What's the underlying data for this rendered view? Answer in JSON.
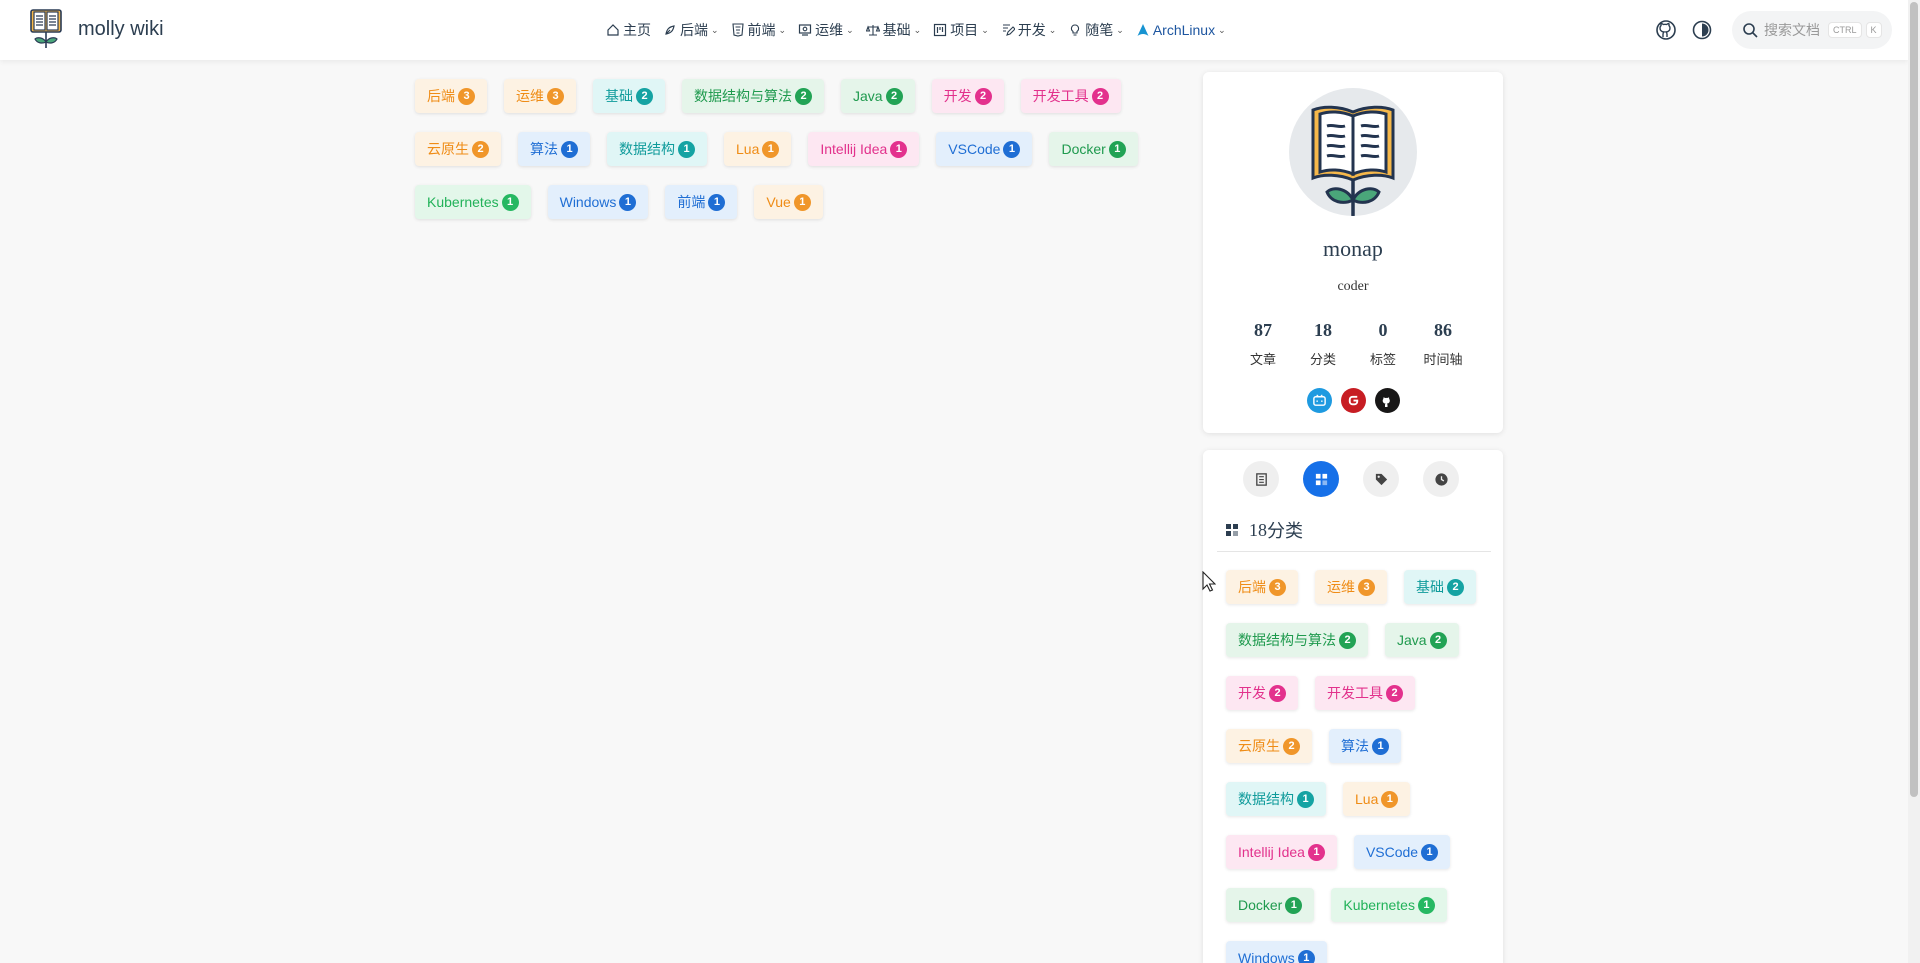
{
  "brand": {
    "title": "molly wiki"
  },
  "nav": {
    "items": [
      {
        "label": "主页",
        "icon": "home-icon",
        "has_menu": false
      },
      {
        "label": "后端",
        "icon": "backend-icon",
        "has_menu": true
      },
      {
        "label": "前端",
        "icon": "html5-icon",
        "has_menu": true
      },
      {
        "label": "运维",
        "icon": "ops-icon",
        "has_menu": true
      },
      {
        "label": "基础",
        "icon": "scale-icon",
        "has_menu": true
      },
      {
        "label": "项目",
        "icon": "project-icon",
        "has_menu": true
      },
      {
        "label": "开发",
        "icon": "edit-icon",
        "has_menu": true
      },
      {
        "label": "随笔",
        "icon": "bulb-icon",
        "has_menu": true
      },
      {
        "label": "ArchLinux",
        "icon": "archlinux-icon",
        "has_menu": true
      }
    ],
    "chevron": "⌄"
  },
  "search": {
    "placeholder": "搜索文档",
    "key1": "CTRL",
    "key2": "K"
  },
  "tags": [
    {
      "label": "后端",
      "count": "3",
      "color": "orange"
    },
    {
      "label": "运维",
      "count": "3",
      "color": "orange"
    },
    {
      "label": "基础",
      "count": "2",
      "color": "cyan"
    },
    {
      "label": "数据结构与算法",
      "count": "2",
      "color": "green"
    },
    {
      "label": "Java",
      "count": "2",
      "color": "green"
    },
    {
      "label": "开发",
      "count": "2",
      "color": "pink"
    },
    {
      "label": "开发工具",
      "count": "2",
      "color": "pink"
    },
    {
      "label": "云原生",
      "count": "2",
      "color": "orange"
    },
    {
      "label": "算法",
      "count": "1",
      "color": "blue"
    },
    {
      "label": "数据结构",
      "count": "1",
      "color": "cyan"
    },
    {
      "label": "Lua",
      "count": "1",
      "color": "orange"
    },
    {
      "label": "Intellij Idea",
      "count": "1",
      "color": "pink"
    },
    {
      "label": "VSCode",
      "count": "1",
      "color": "blue"
    },
    {
      "label": "Docker",
      "count": "1",
      "color": "green"
    },
    {
      "label": "Kubernetes",
      "count": "1",
      "color": "lime"
    },
    {
      "label": "Windows",
      "count": "1",
      "color": "blue"
    },
    {
      "label": "前端",
      "count": "1",
      "color": "blue"
    },
    {
      "label": "Vue",
      "count": "1",
      "color": "orange"
    }
  ],
  "profile": {
    "name": "monap",
    "description": "coder",
    "stats": [
      {
        "value": "87",
        "label": "文章"
      },
      {
        "value": "18",
        "label": "分类"
      },
      {
        "value": "0",
        "label": "标签"
      },
      {
        "value": "86",
        "label": "时间轴"
      }
    ],
    "socials": [
      {
        "name": "bilibili-icon",
        "color": "#1e9ae0"
      },
      {
        "name": "gitee-icon",
        "color": "#c71d23"
      },
      {
        "name": "github-icon",
        "color": "#181717"
      }
    ]
  },
  "sidebar": {
    "category_count": "18",
    "category_label": "分类",
    "tabs": [
      "article-list-icon",
      "category-icon",
      "tag-icon",
      "timeline-icon"
    ],
    "tags": [
      {
        "label": "后端",
        "count": "3",
        "color": "orange"
      },
      {
        "label": "运维",
        "count": "3",
        "color": "orange"
      },
      {
        "label": "基础",
        "count": "2",
        "color": "cyan"
      },
      {
        "label": "数据结构与算法",
        "count": "2",
        "color": "green"
      },
      {
        "label": "Java",
        "count": "2",
        "color": "green"
      },
      {
        "label": "开发",
        "count": "2",
        "color": "pink"
      },
      {
        "label": "开发工具",
        "count": "2",
        "color": "pink"
      },
      {
        "label": "云原生",
        "count": "2",
        "color": "orange"
      },
      {
        "label": "算法",
        "count": "1",
        "color": "blue"
      },
      {
        "label": "数据结构",
        "count": "1",
        "color": "cyan"
      },
      {
        "label": "Lua",
        "count": "1",
        "color": "orange"
      },
      {
        "label": "Intellij Idea",
        "count": "1",
        "color": "pink"
      },
      {
        "label": "VSCode",
        "count": "1",
        "color": "blue"
      },
      {
        "label": "Docker",
        "count": "1",
        "color": "green"
      },
      {
        "label": "Kubernetes",
        "count": "1",
        "color": "lime"
      },
      {
        "label": "Windows",
        "count": "1",
        "color": "blue"
      }
    ]
  },
  "colors": {
    "accent": "#1670e8",
    "orange": "#f0962a",
    "cyan": "#15a3a3",
    "green": "#22a355",
    "pink": "#e3318d",
    "blue": "#1f6ed4",
    "lime": "#26b862"
  }
}
